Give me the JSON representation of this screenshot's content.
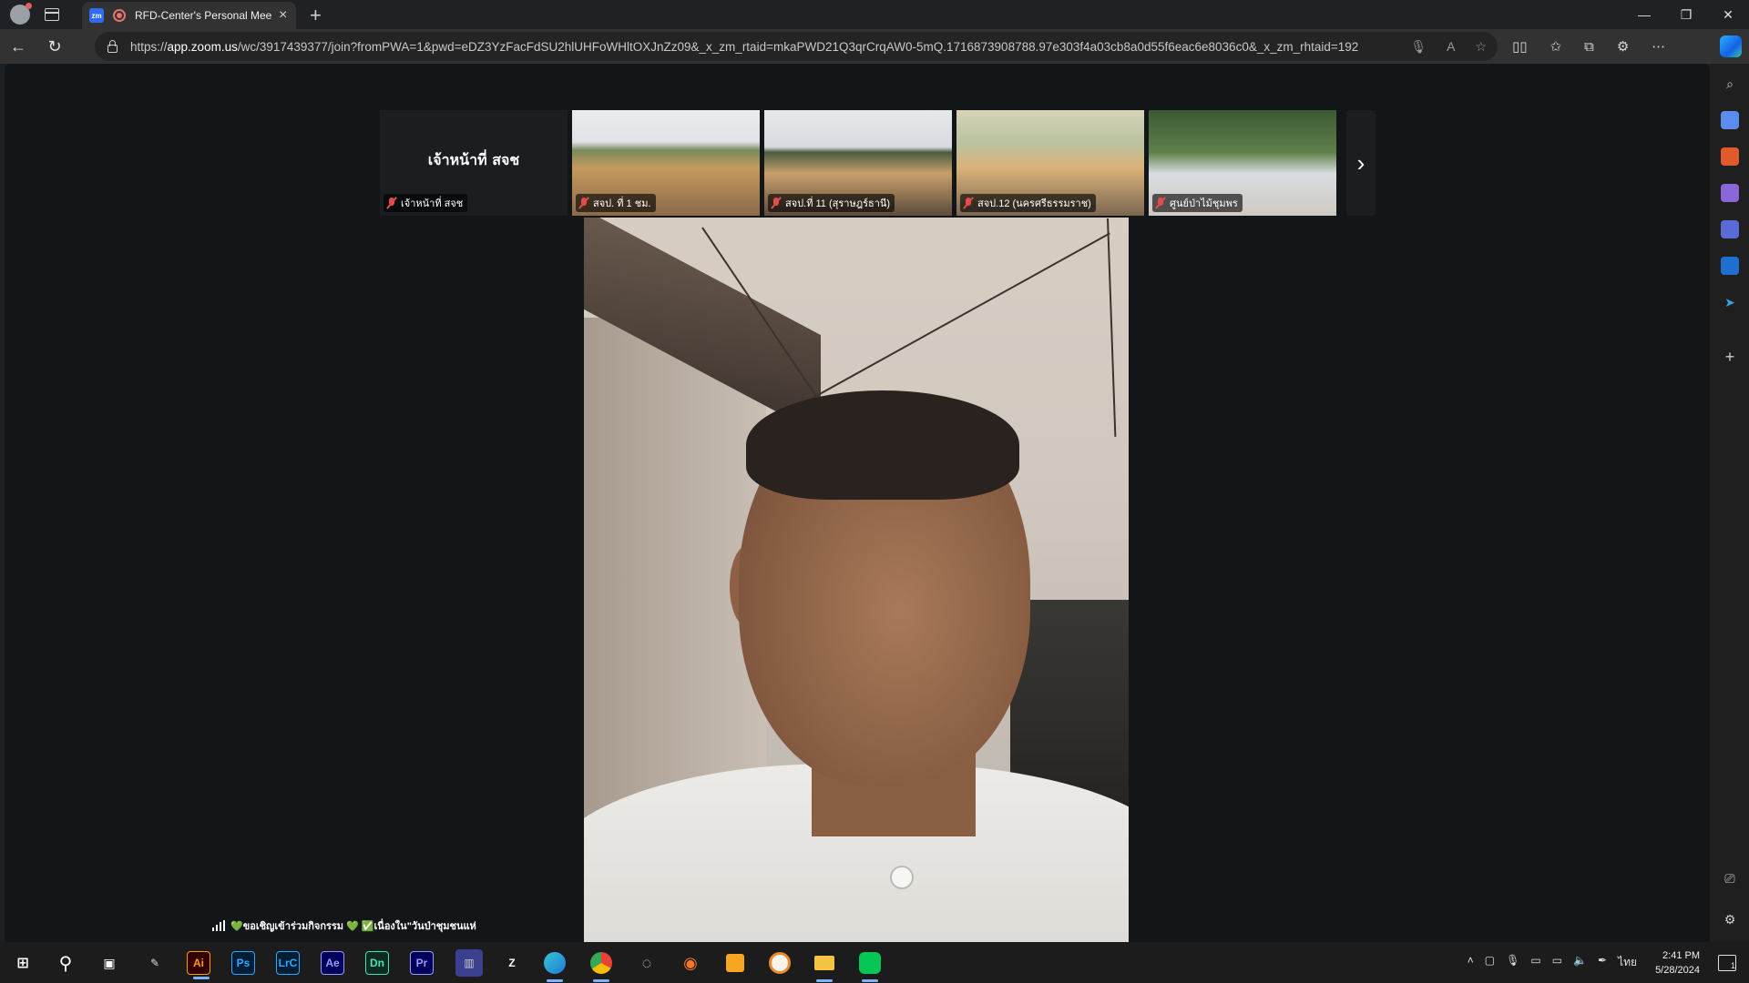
{
  "browser": {
    "tab_title": "RFD-Center's Personal Meeting Room",
    "tab_favicon": "zm",
    "url_prefix": "https://",
    "url_host": "app.zoom.us",
    "url_path": "/wc/3917439377/join?fromPWA=1&pwd=eDZ3YzFacFdSU2hlUHFoWHltOXJnZz09&_x_zm_rtaid=mkaPWD21Q3qrCrqAW0-5mQ.1716873908788.97e303f4a03cb8a0d55f6eac6e8036c0&_x_zm_rhtaid=192",
    "window_controls": [
      "—",
      "❐",
      "✕"
    ]
  },
  "meeting": {
    "participants": [
      {
        "label": "เจ้าหน้าที่ สจช",
        "big_name": "เจ้าหน้าที่ สจช",
        "video": false,
        "muted": true
      },
      {
        "label": "สจป. ที่ 1 ชม.",
        "video": true,
        "muted": true
      },
      {
        "label": "สจป.ที่ 11 (สุราษฎร์ธานี)",
        "video": true,
        "muted": true
      },
      {
        "label": "สจป.12 (นครศรีธรรมราช)",
        "video": true,
        "muted": true
      },
      {
        "label": "ศูนย์ป่าไม้ชุมพร",
        "video": true,
        "muted": true
      }
    ],
    "next_icon": "chevron-right-icon",
    "ticker_text": "💚ขอเชิญเข้าร่วมกิจกรรม 💚 ✅เนื่องใน\"วันป่าชุมชนแห่"
  },
  "taskbar": {
    "apps": [
      {
        "name": "illustrator",
        "label": "Ai",
        "color": "#ff9a00",
        "bg": "#330000"
      },
      {
        "name": "photoshop",
        "label": "Ps",
        "color": "#31a8ff",
        "bg": "#001e36"
      },
      {
        "name": "lightroom-classic",
        "label": "LrC",
        "color": "#31a8ff",
        "bg": "#001e36"
      },
      {
        "name": "after-effects",
        "label": "Ae",
        "color": "#9999ff",
        "bg": "#00005b"
      },
      {
        "name": "dimension",
        "label": "Dn",
        "color": "#4ee0b5",
        "bg": "#0c2c21"
      },
      {
        "name": "premiere",
        "label": "Pr",
        "color": "#9999ff",
        "bg": "#00005b"
      }
    ],
    "time": "2:41 PM",
    "date": "5/28/2024",
    "language": "ไทย",
    "notification_count": "1"
  }
}
